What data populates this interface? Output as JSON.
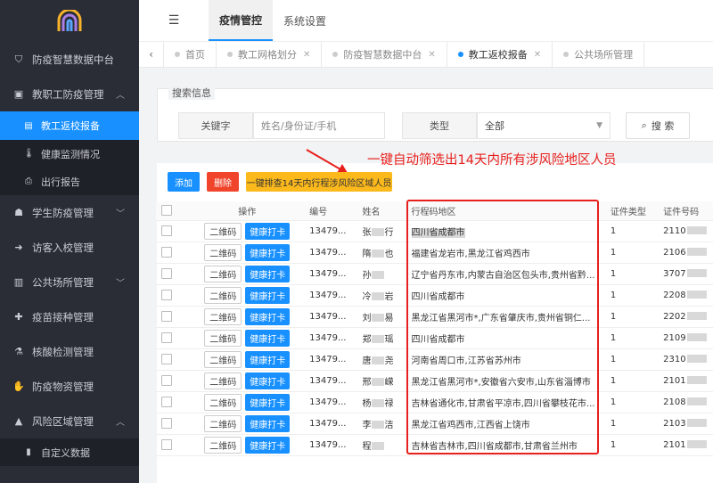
{
  "sidebar": {
    "logo_icon": "arch-logo-icon",
    "items": [
      {
        "icon": "shield-icon",
        "label": "防疫智慧数据中台"
      },
      {
        "icon": "briefcase-icon",
        "label": "教职工防疫管理"
      },
      {
        "icon": "student-icon",
        "label": "学生防疫管理"
      },
      {
        "icon": "login-icon",
        "label": "访客入校管理"
      },
      {
        "icon": "building-icon",
        "label": "公共场所管理"
      },
      {
        "icon": "syringe-icon",
        "label": "疫苗接种管理"
      },
      {
        "icon": "flask-icon",
        "label": "核酸检测管理"
      },
      {
        "icon": "supplies-icon",
        "label": "防疫物资管理"
      },
      {
        "icon": "warning-icon",
        "label": "风险区域管理"
      }
    ],
    "staff_submenu": [
      {
        "icon": "doc-icon",
        "label": "教工返校报备"
      },
      {
        "icon": "thermometer-icon",
        "label": "健康监测情况"
      },
      {
        "icon": "pdf-icon",
        "label": "出行报告"
      }
    ],
    "risk_submenu": [
      {
        "icon": "bar-chart-icon",
        "label": "自定义数据"
      }
    ]
  },
  "topbar": {
    "tabs": [
      "疫情管控",
      "系统设置"
    ]
  },
  "tabs": [
    "首页",
    "教工网格划分",
    "防疫智慧数据中台",
    "教工返校报备",
    "公共场所管理"
  ],
  "search": {
    "legend": "搜索信息",
    "keyword_label": "关键字",
    "keyword_placeholder": "姓名/身份证/手机",
    "type_label": "类型",
    "type_value": "全部",
    "search_label": "搜 索"
  },
  "toolbar": {
    "add": "添加",
    "delete": "删除",
    "screen": "一键排查14天内行程涉风险区域人员"
  },
  "annotation": "一键自动筛选出14天内所有涉风险地区人员",
  "table": {
    "headers": [
      "",
      "操作",
      "编号",
      "姓名",
      "行程码地区",
      "证件类型",
      "证件号码"
    ],
    "qr_label": "二维码",
    "health_label": "健康打卡",
    "rows": [
      {
        "id": "13479...",
        "name": "张",
        "name2": "行",
        "region": "四川省成都市",
        "idtype": "1",
        "idno": "2110"
      },
      {
        "id": "13479...",
        "name": "隋",
        "name2": "也",
        "region": "福建省龙岩市,黑龙江省鸡西市",
        "idtype": "1",
        "idno": "2106"
      },
      {
        "id": "13479...",
        "name": "孙",
        "name2": "",
        "region": "辽宁省丹东市,内蒙古自治区包头市,贵州省黔...",
        "idtype": "1",
        "idno": "3707"
      },
      {
        "id": "13479...",
        "name": "冷",
        "name2": "岩",
        "region": "四川省成都市",
        "idtype": "1",
        "idno": "2208"
      },
      {
        "id": "13479...",
        "name": "刘",
        "name2": "易",
        "region": "黑龙江省黑河市*,广东省肇庆市,贵州省铜仁...",
        "idtype": "1",
        "idno": "2202"
      },
      {
        "id": "13479...",
        "name": "郑",
        "name2": "瑶",
        "region": "四川省成都市",
        "idtype": "1",
        "idno": "2109"
      },
      {
        "id": "13479...",
        "name": "唐",
        "name2": "尧",
        "region": "河南省周口市,江苏省苏州市",
        "idtype": "1",
        "idno": "2310"
      },
      {
        "id": "13479...",
        "name": "邢",
        "name2": "嵘",
        "region": "黑龙江省黑河市*,安徽省六安市,山东省淄博市",
        "idtype": "1",
        "idno": "2101"
      },
      {
        "id": "13479...",
        "name": "杨",
        "name2": "禄",
        "region": "吉林省通化市,甘肃省平凉市,四川省攀枝花市...",
        "idtype": "1",
        "idno": "2108"
      },
      {
        "id": "13479...",
        "name": "李",
        "name2": "洁",
        "region": "黑龙江省鸡西市,江西省上饶市",
        "idtype": "1",
        "idno": "2103"
      },
      {
        "id": "13479...",
        "name": "程",
        "name2": "",
        "region": "吉林省吉林市,四川省成都市,甘肃省兰州市",
        "idtype": "1",
        "idno": "2101"
      }
    ]
  },
  "colors": {
    "sidebar_bg": "#2a2d36",
    "accent": "#1890ff",
    "danger": "#f0442b",
    "warning": "#fcb91c",
    "annotation": "#e8201d"
  }
}
